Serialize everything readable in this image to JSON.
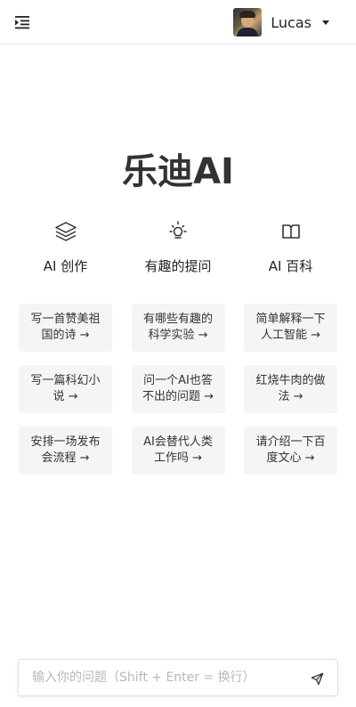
{
  "header": {
    "menu_icon": "menu-fold-icon",
    "user": {
      "name": "Lucas",
      "avatar": "user-avatar",
      "caret_icon": "caret-down-icon"
    }
  },
  "main": {
    "title": "乐迪AI",
    "columns": [
      {
        "icon": "layers-icon",
        "title": "AI 创作",
        "cards": [
          {
            "text": "写一首赞美祖国的诗 →"
          },
          {
            "text": "写一篇科幻小说 →"
          },
          {
            "text": "安排一场发布会流程 →"
          }
        ]
      },
      {
        "icon": "bulb-icon",
        "title": "有趣的提问",
        "cards": [
          {
            "text": "有哪些有趣的科学实验 →"
          },
          {
            "text": "问一个AI也答不出的问题 →"
          },
          {
            "text": "AI会替代人类工作吗 →"
          }
        ]
      },
      {
        "icon": "book-icon",
        "title": "AI 百科",
        "cards": [
          {
            "text": "简单解释一下人工智能 →"
          },
          {
            "text": "红烧牛肉的做法 →"
          },
          {
            "text": "请介绍一下百度文心 →"
          }
        ]
      }
    ]
  },
  "input": {
    "placeholder": "输入你的问题（Shift + Enter = 换行）",
    "value": "",
    "send_icon": "send-icon"
  }
}
